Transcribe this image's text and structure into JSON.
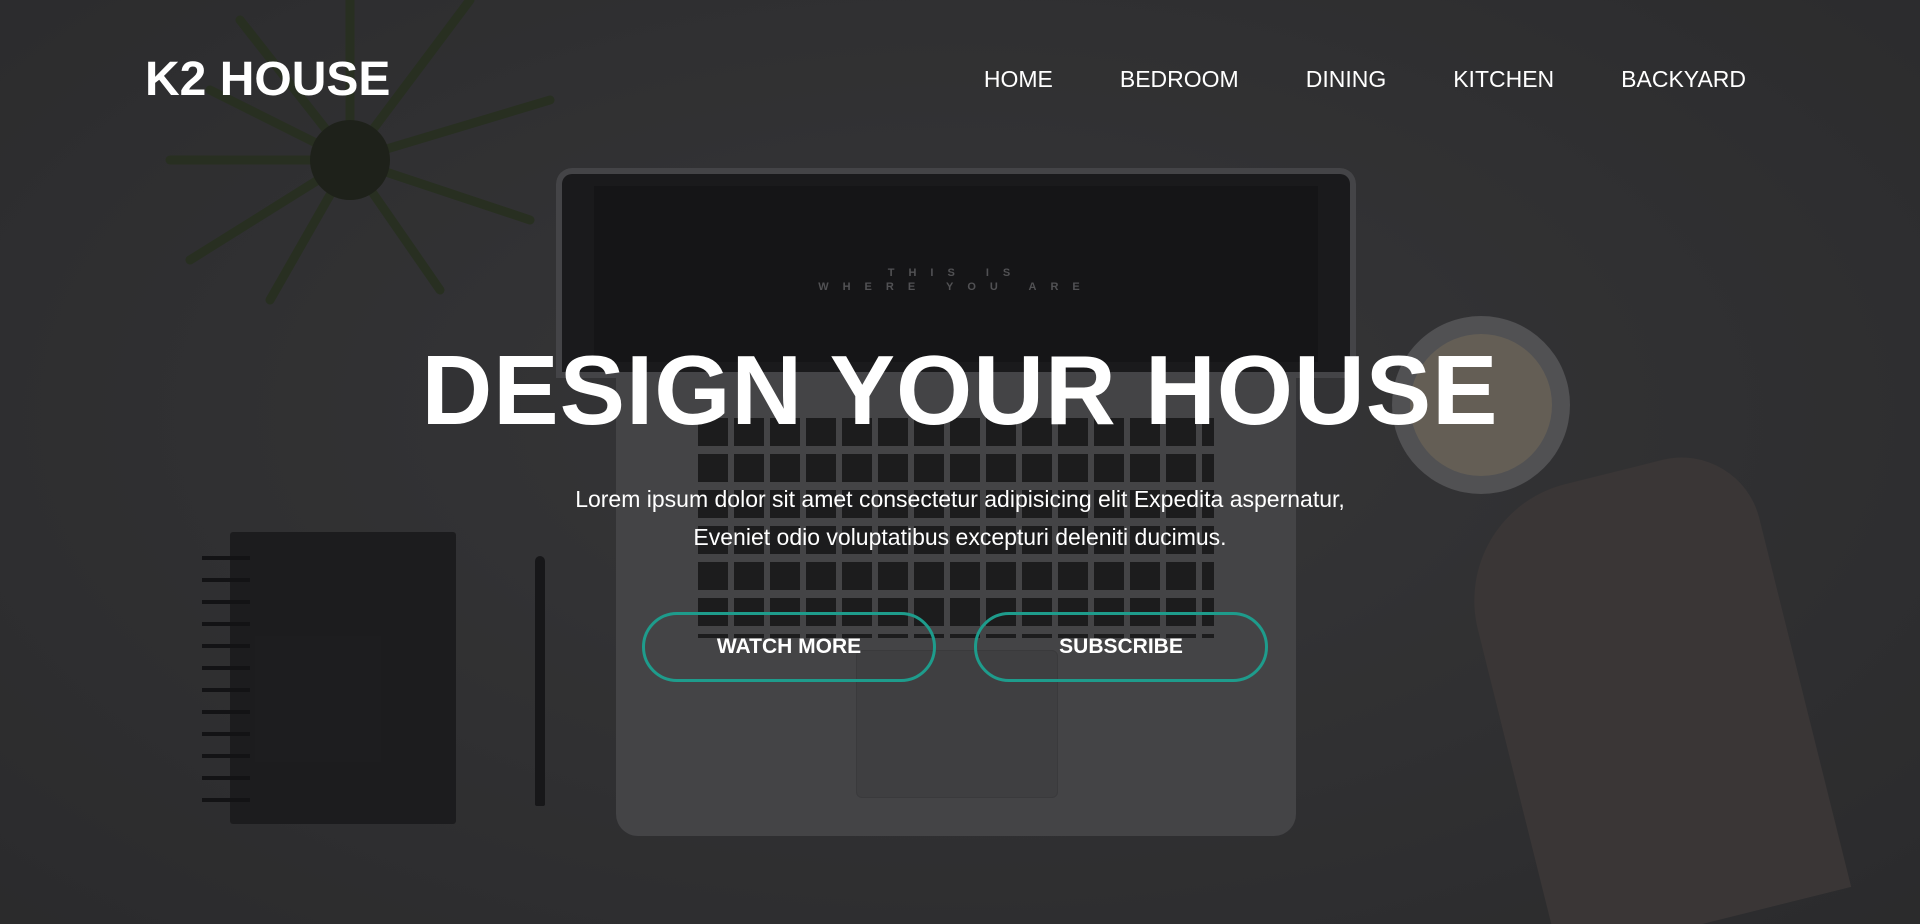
{
  "header": {
    "logo": "K2 HOUSE",
    "nav": [
      "HOME",
      "BEDROOM",
      "DINING",
      "KITCHEN",
      "BACKYARD"
    ]
  },
  "hero": {
    "headline": "DESIGN YOUR HOUSE",
    "subtext_line1": "Lorem ipsum dolor sit amet consectetur adipisicing elit Expedita aspernatur,",
    "subtext_line2": "Eveniet odio voluptatibus excepturi deleniti ducimus.",
    "buttons": {
      "watch_more": "WATCH MORE",
      "subscribe": "SUBSCRIBE"
    },
    "background_screen_text": {
      "line1": "THIS IS",
      "line2": "WHERE YOU ARE"
    }
  },
  "colors": {
    "accent": "#1e9c8c",
    "text": "#ffffff",
    "background": "#3a3a3b"
  },
  "icons": [
    "plant-image",
    "laptop-image",
    "notebook-image",
    "pen-image",
    "coffee-cup-image",
    "hand-image"
  ]
}
